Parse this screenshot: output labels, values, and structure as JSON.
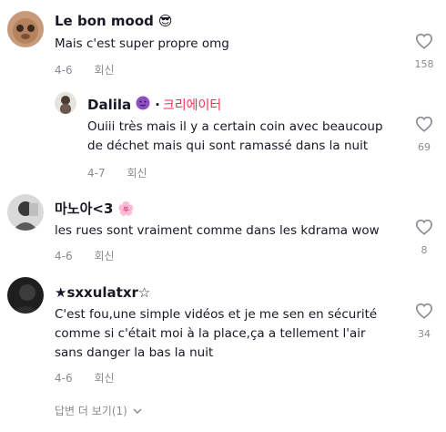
{
  "comments": [
    {
      "username": "Le bon mood",
      "emoji": "😎",
      "text_lines": [
        "Mais c'est super propre omg"
      ],
      "date": "4-6",
      "reply_label": "회신",
      "likes": "158"
    },
    {
      "username": "Dalila",
      "emoji": "🟣",
      "creator_dot": "·",
      "creator_label": "크리에이터",
      "text_lines": [
        "Ouiii très mais il y a certain coin avec beaucoup",
        "de déchet mais qui sont ramassé dans la nuit"
      ],
      "date": "4-7",
      "reply_label": "회신",
      "likes": "69"
    },
    {
      "username": "마노아<3",
      "emoji": "🌸",
      "text_lines": [
        "les rues sont vraiment comme dans les kdrama wow"
      ],
      "date": "4-6",
      "reply_label": "회신",
      "likes": "8"
    },
    {
      "username": "★sxxulatxr☆",
      "emoji": "",
      "text_lines": [
        "C'est fou,une simple vidéos et je me sen en sécurité",
        "comme si c'était moi à la place,ça a tellement l'air",
        "sans danger la bas la nuit"
      ],
      "date": "4-6",
      "reply_label": "회신",
      "likes": "34"
    }
  ],
  "view_replies": {
    "label": "답변 더 보기(1)",
    "icon": "chevron-down-icon"
  },
  "colors": {
    "accent": "#fe2c55",
    "muted": "#8a8b91",
    "text": "#161823"
  }
}
